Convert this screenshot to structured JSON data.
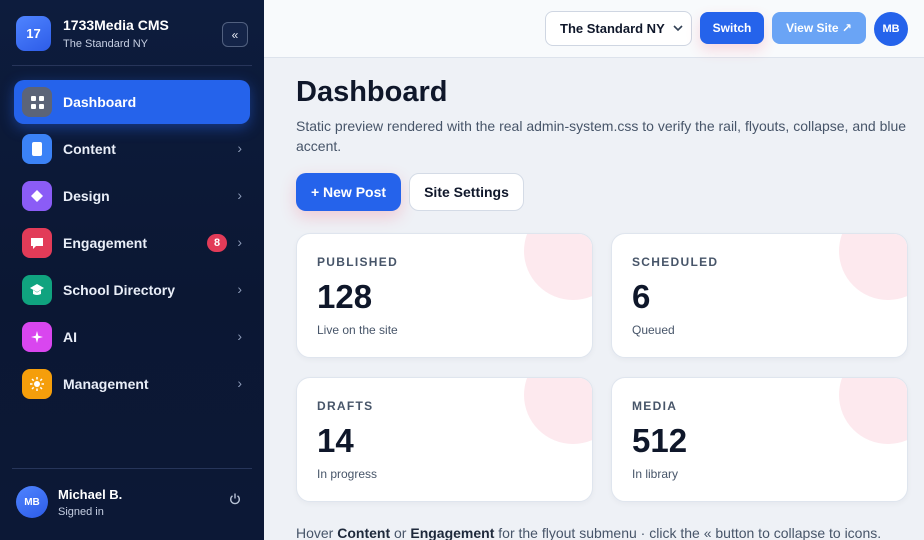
{
  "brand": {
    "logo_text": "17",
    "title": "1733Media CMS",
    "subtitle": "The Standard NY",
    "collapse_label": "«"
  },
  "sidebar": {
    "items": [
      {
        "label": "Dashboard",
        "icon": "grid-icon",
        "active": true
      },
      {
        "label": "Content",
        "icon": "document-icon",
        "chevron": "›"
      },
      {
        "label": "Design",
        "icon": "diamond-icon",
        "chevron": "›"
      },
      {
        "label": "Engagement",
        "icon": "chat-bubble-icon",
        "badge": "8",
        "chevron": "›"
      },
      {
        "label": "School Directory",
        "icon": "graduation-cap-icon",
        "chevron": "›"
      },
      {
        "label": "AI",
        "icon": "sparkle-icon",
        "chevron": "›"
      },
      {
        "label": "Management",
        "icon": "sun-gear-icon",
        "chevron": "›"
      }
    ],
    "icon_colors": [
      "#5c6478",
      "#3b82f6",
      "#8b5cf6",
      "#e23b58",
      "#10a37f",
      "#d946ef",
      "#f59e0b"
    ]
  },
  "user": {
    "initials": "MB",
    "name": "Michael B.",
    "status": "Signed in"
  },
  "topbar": {
    "site_select_value": "The Standard NY",
    "switch_label": "Switch",
    "view_site_label": "View Site ↗",
    "avatar_initials": "MB"
  },
  "main": {
    "title": "Dashboard",
    "description": "Static preview rendered with the real admin-system.css to verify the rail, flyouts, collapse, and blue accent.",
    "new_post_label": "+ New Post",
    "site_settings_label": "Site Settings",
    "stats": [
      {
        "label": "PUBLISHED",
        "value": "128",
        "sub": "Live on the site"
      },
      {
        "label": "SCHEDULED",
        "value": "6",
        "sub": "Queued"
      },
      {
        "label": "DRAFTS",
        "value": "14",
        "sub": "In progress"
      },
      {
        "label": "MEDIA",
        "value": "512",
        "sub": "In library"
      }
    ],
    "footer": {
      "p1": "Hover ",
      "b1": "Content",
      "p2": " or ",
      "b2": "Engagement",
      "p3": " for the flyout submenu · click the « button to collapse to icons."
    }
  },
  "colors": {
    "accent": "#2563eb",
    "sidebar_bg": "#0b1733",
    "badge": "#e23b58"
  }
}
